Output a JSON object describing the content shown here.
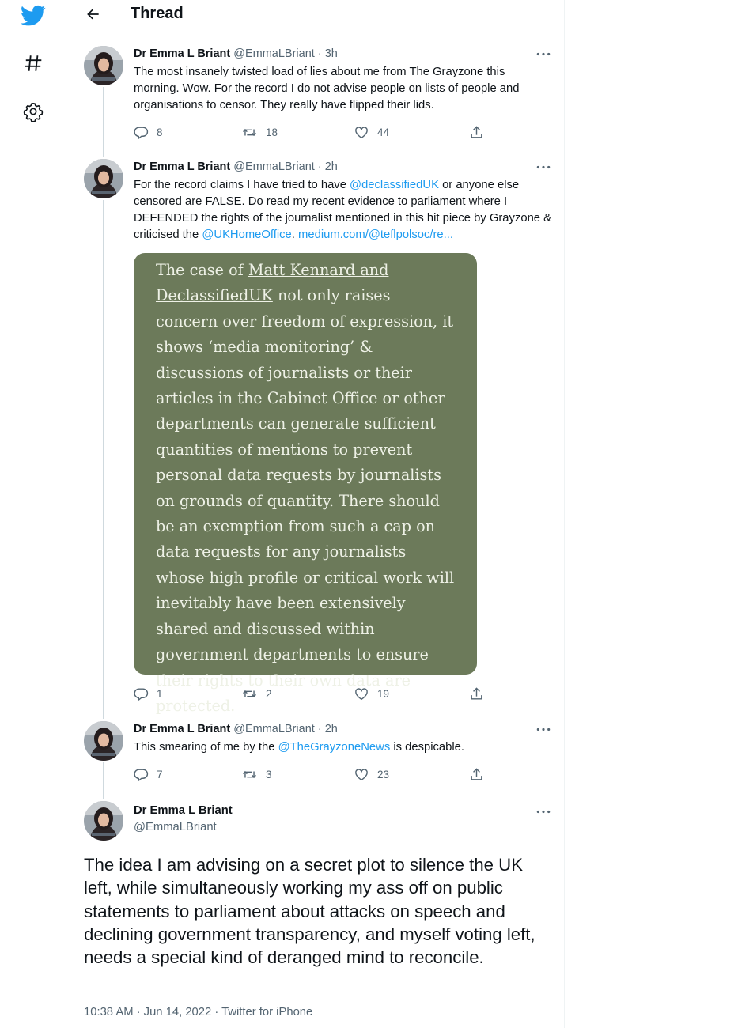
{
  "header": {
    "title": "Thread"
  },
  "tweets": [
    {
      "name": "Dr Emma L Briant",
      "handle": "@EmmaLBriant",
      "time": " · 3h",
      "text": "The most insanely twisted load of lies about me from The Grayzone this morning. Wow. For the record I do not advise people on lists of people and organisations to censor. They really have flipped their lids.",
      "replies": "8",
      "retweets": "18",
      "likes": "44"
    },
    {
      "name": "Dr Emma L Briant",
      "handle": "@EmmaLBriant",
      "time": " · 2h",
      "text_a": "For the record claims I have tried to have ",
      "mention_a": "@declassifiedUK",
      "text_b": " or anyone else censored are FALSE. Do read my recent evidence to parliament where I DEFENDED the rights of the journalist mentioned in this hit piece by Grayzone & criticised the ",
      "mention_b": "@UKHomeOffice",
      "text_c": ". ",
      "url": "medium.com/@teflpolsoc/re...",
      "quote": {
        "lead": "The case of ",
        "underlined": "Matt Kennard and DeclassifiedUK",
        "body": " not only raises concern over freedom of expression, it shows ‘media monitoring’ & discussions of journalists or their articles in the Cabinet Office or other departments can generate sufficient quantities of mentions to prevent personal data requests by journalists on grounds of quantity. There should be an exemption from such a cap on data requests for any journalists whose high profile or critical work will inevitably have been extensively shared and discussed within government departments to ensure their rights to their own data are protected."
      },
      "replies": "1",
      "retweets": "2",
      "likes": "19"
    },
    {
      "name": "Dr Emma L Briant",
      "handle": "@EmmaLBriant",
      "time": " · 2h",
      "text_a": "This smearing of me by the ",
      "mention": "@TheGrayzoneNews",
      "text_b": " is despicable.",
      "replies": "7",
      "retweets": "3",
      "likes": "23"
    }
  ],
  "main_tweet": {
    "name": "Dr Emma L Briant",
    "handle": "@EmmaLBriant",
    "text": "The idea I am advising on a secret plot to silence the UK left, while simultaneously working my ass off on public statements to parliament about attacks on speech and declining government transparency, and myself voting left, needs a special kind of deranged mind to reconcile.",
    "meta": "10:38 AM · Jun 14, 2022 · Twitter for iPhone"
  },
  "icons": [
    "twitter-logo-icon",
    "hashtag-icon",
    "gear-icon",
    "back-arrow-icon",
    "more-icon",
    "reply-icon",
    "retweet-icon",
    "like-icon",
    "share-icon"
  ],
  "colors": {
    "brand": "#1d9bf0",
    "link": "#1d9bf0",
    "quote_bg": "#6c7a5a",
    "muted": "#536471"
  }
}
